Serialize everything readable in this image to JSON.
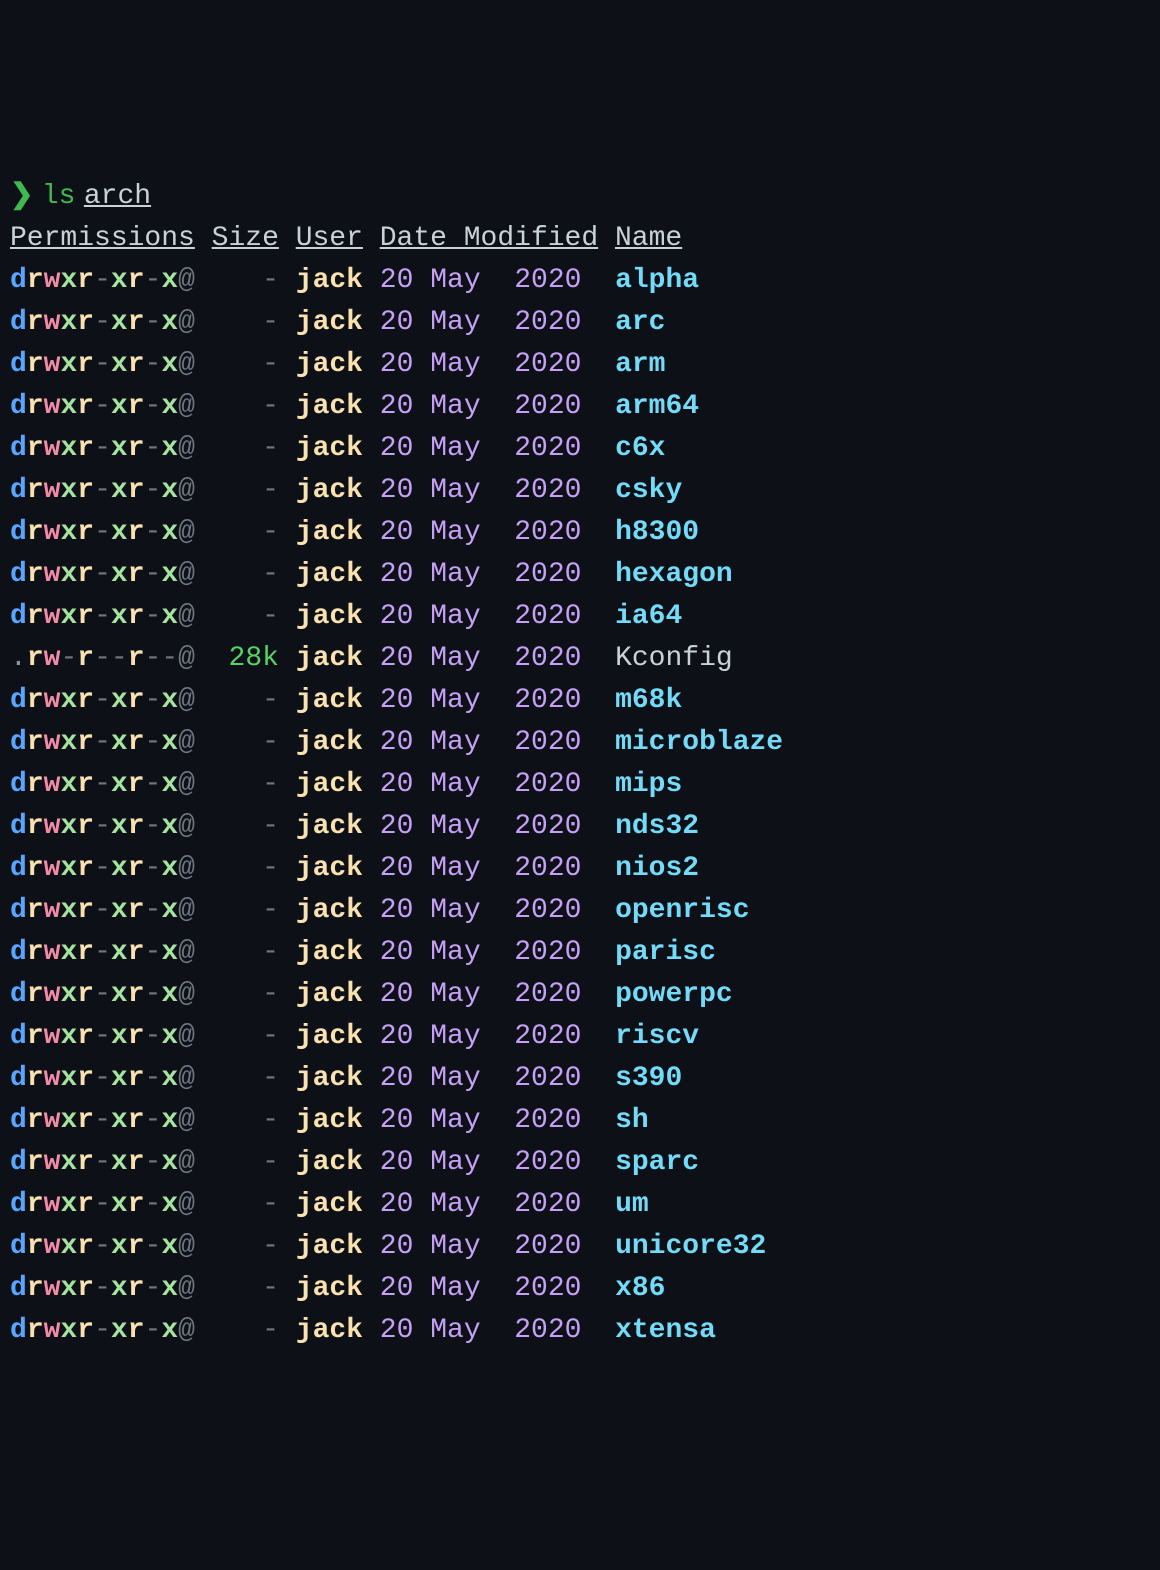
{
  "prompt": {
    "symbol": "❯",
    "command": "ls",
    "argument": "arch"
  },
  "headers": {
    "permissions": "Permissions",
    "size": "Size",
    "user": "User",
    "date_modified": "Date Modified",
    "name": "Name"
  },
  "rows": [
    {
      "type": "dir",
      "perm": "drwxr-xr-x@",
      "size": "-",
      "user": "jack",
      "day": "20",
      "month": "May",
      "year": "2020",
      "name": "alpha"
    },
    {
      "type": "dir",
      "perm": "drwxr-xr-x@",
      "size": "-",
      "user": "jack",
      "day": "20",
      "month": "May",
      "year": "2020",
      "name": "arc"
    },
    {
      "type": "dir",
      "perm": "drwxr-xr-x@",
      "size": "-",
      "user": "jack",
      "day": "20",
      "month": "May",
      "year": "2020",
      "name": "arm"
    },
    {
      "type": "dir",
      "perm": "drwxr-xr-x@",
      "size": "-",
      "user": "jack",
      "day": "20",
      "month": "May",
      "year": "2020",
      "name": "arm64"
    },
    {
      "type": "dir",
      "perm": "drwxr-xr-x@",
      "size": "-",
      "user": "jack",
      "day": "20",
      "month": "May",
      "year": "2020",
      "name": "c6x"
    },
    {
      "type": "dir",
      "perm": "drwxr-xr-x@",
      "size": "-",
      "user": "jack",
      "day": "20",
      "month": "May",
      "year": "2020",
      "name": "csky"
    },
    {
      "type": "dir",
      "perm": "drwxr-xr-x@",
      "size": "-",
      "user": "jack",
      "day": "20",
      "month": "May",
      "year": "2020",
      "name": "h8300"
    },
    {
      "type": "dir",
      "perm": "drwxr-xr-x@",
      "size": "-",
      "user": "jack",
      "day": "20",
      "month": "May",
      "year": "2020",
      "name": "hexagon"
    },
    {
      "type": "dir",
      "perm": "drwxr-xr-x@",
      "size": "-",
      "user": "jack",
      "day": "20",
      "month": "May",
      "year": "2020",
      "name": "ia64"
    },
    {
      "type": "file",
      "perm": ".rw-r--r--@",
      "size": "28k",
      "user": "jack",
      "day": "20",
      "month": "May",
      "year": "2020",
      "name": "Kconfig"
    },
    {
      "type": "dir",
      "perm": "drwxr-xr-x@",
      "size": "-",
      "user": "jack",
      "day": "20",
      "month": "May",
      "year": "2020",
      "name": "m68k"
    },
    {
      "type": "dir",
      "perm": "drwxr-xr-x@",
      "size": "-",
      "user": "jack",
      "day": "20",
      "month": "May",
      "year": "2020",
      "name": "microblaze"
    },
    {
      "type": "dir",
      "perm": "drwxr-xr-x@",
      "size": "-",
      "user": "jack",
      "day": "20",
      "month": "May",
      "year": "2020",
      "name": "mips"
    },
    {
      "type": "dir",
      "perm": "drwxr-xr-x@",
      "size": "-",
      "user": "jack",
      "day": "20",
      "month": "May",
      "year": "2020",
      "name": "nds32"
    },
    {
      "type": "dir",
      "perm": "drwxr-xr-x@",
      "size": "-",
      "user": "jack",
      "day": "20",
      "month": "May",
      "year": "2020",
      "name": "nios2"
    },
    {
      "type": "dir",
      "perm": "drwxr-xr-x@",
      "size": "-",
      "user": "jack",
      "day": "20",
      "month": "May",
      "year": "2020",
      "name": "openrisc"
    },
    {
      "type": "dir",
      "perm": "drwxr-xr-x@",
      "size": "-",
      "user": "jack",
      "day": "20",
      "month": "May",
      "year": "2020",
      "name": "parisc"
    },
    {
      "type": "dir",
      "perm": "drwxr-xr-x@",
      "size": "-",
      "user": "jack",
      "day": "20",
      "month": "May",
      "year": "2020",
      "name": "powerpc"
    },
    {
      "type": "dir",
      "perm": "drwxr-xr-x@",
      "size": "-",
      "user": "jack",
      "day": "20",
      "month": "May",
      "year": "2020",
      "name": "riscv"
    },
    {
      "type": "dir",
      "perm": "drwxr-xr-x@",
      "size": "-",
      "user": "jack",
      "day": "20",
      "month": "May",
      "year": "2020",
      "name": "s390"
    },
    {
      "type": "dir",
      "perm": "drwxr-xr-x@",
      "size": "-",
      "user": "jack",
      "day": "20",
      "month": "May",
      "year": "2020",
      "name": "sh"
    },
    {
      "type": "dir",
      "perm": "drwxr-xr-x@",
      "size": "-",
      "user": "jack",
      "day": "20",
      "month": "May",
      "year": "2020",
      "name": "sparc"
    },
    {
      "type": "dir",
      "perm": "drwxr-xr-x@",
      "size": "-",
      "user": "jack",
      "day": "20",
      "month": "May",
      "year": "2020",
      "name": "um"
    },
    {
      "type": "dir",
      "perm": "drwxr-xr-x@",
      "size": "-",
      "user": "jack",
      "day": "20",
      "month": "May",
      "year": "2020",
      "name": "unicore32"
    },
    {
      "type": "dir",
      "perm": "drwxr-xr-x@",
      "size": "-",
      "user": "jack",
      "day": "20",
      "month": "May",
      "year": "2020",
      "name": "x86"
    },
    {
      "type": "dir",
      "perm": "drwxr-xr-x@",
      "size": "-",
      "user": "jack",
      "day": "20",
      "month": "May",
      "year": "2020",
      "name": "xtensa"
    }
  ]
}
